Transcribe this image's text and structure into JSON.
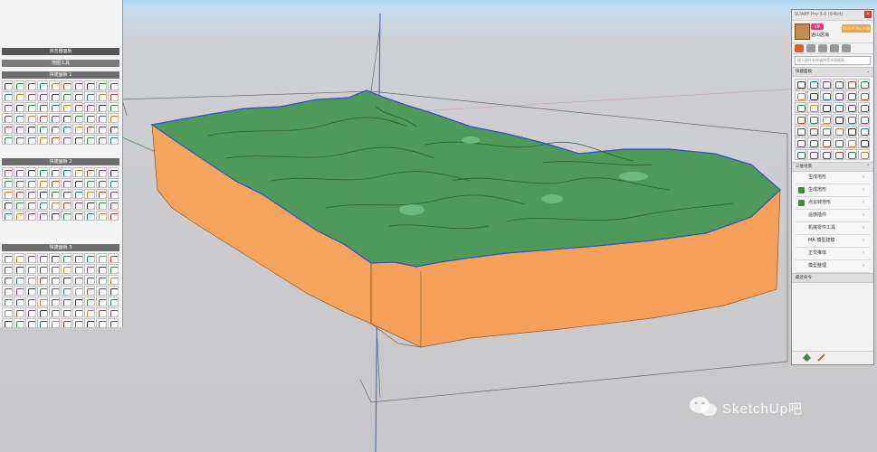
{
  "left_panel": {
    "header_1": "浏览器面板",
    "header_2": "地图工具",
    "sections": [
      {
        "title": "快捷面板 1",
        "icon_count": 60
      },
      {
        "title": "快捷面板 2",
        "icon_count": 50
      },
      {
        "title": "快捷面板 3",
        "icon_count": 70
      }
    ]
  },
  "right_panel": {
    "title": "SUAPP Pro 3.6 (64bit)",
    "close_label": "×",
    "vip_badge": "VIP",
    "username": "逍山居海",
    "upgrade_button": "SUAPP Pro 升级",
    "search_placeholder": "输入插件名称或拼音字母搜索",
    "section_quick": "快捷面板",
    "section_terrain": "三维地景",
    "icon_count": 42,
    "menu_items": [
      {
        "label": "生成地形",
        "icon": false
      },
      {
        "label": "生成地形",
        "icon": true
      },
      {
        "label": "点云转地形",
        "icon": true
      },
      {
        "label": "遥感插件",
        "icon": false
      },
      {
        "label": "机械零件工具",
        "icon": false
      },
      {
        "label": "MA 模型建模",
        "icon": false
      },
      {
        "label": "正交推体",
        "icon": false
      },
      {
        "label": "模型整理",
        "icon": false
      }
    ],
    "section_recent": "最近命令",
    "bottom_icons": [
      "terrain-icon",
      "pencil-icon"
    ]
  },
  "watermark": {
    "text": "SketchUp吧"
  },
  "colors": {
    "terrain_top": "#4e9a5a",
    "terrain_side": "#f6a05a",
    "terrain_outline": "#3050c0",
    "sky": "#aed7f2",
    "ground": "#c8c8cb"
  }
}
